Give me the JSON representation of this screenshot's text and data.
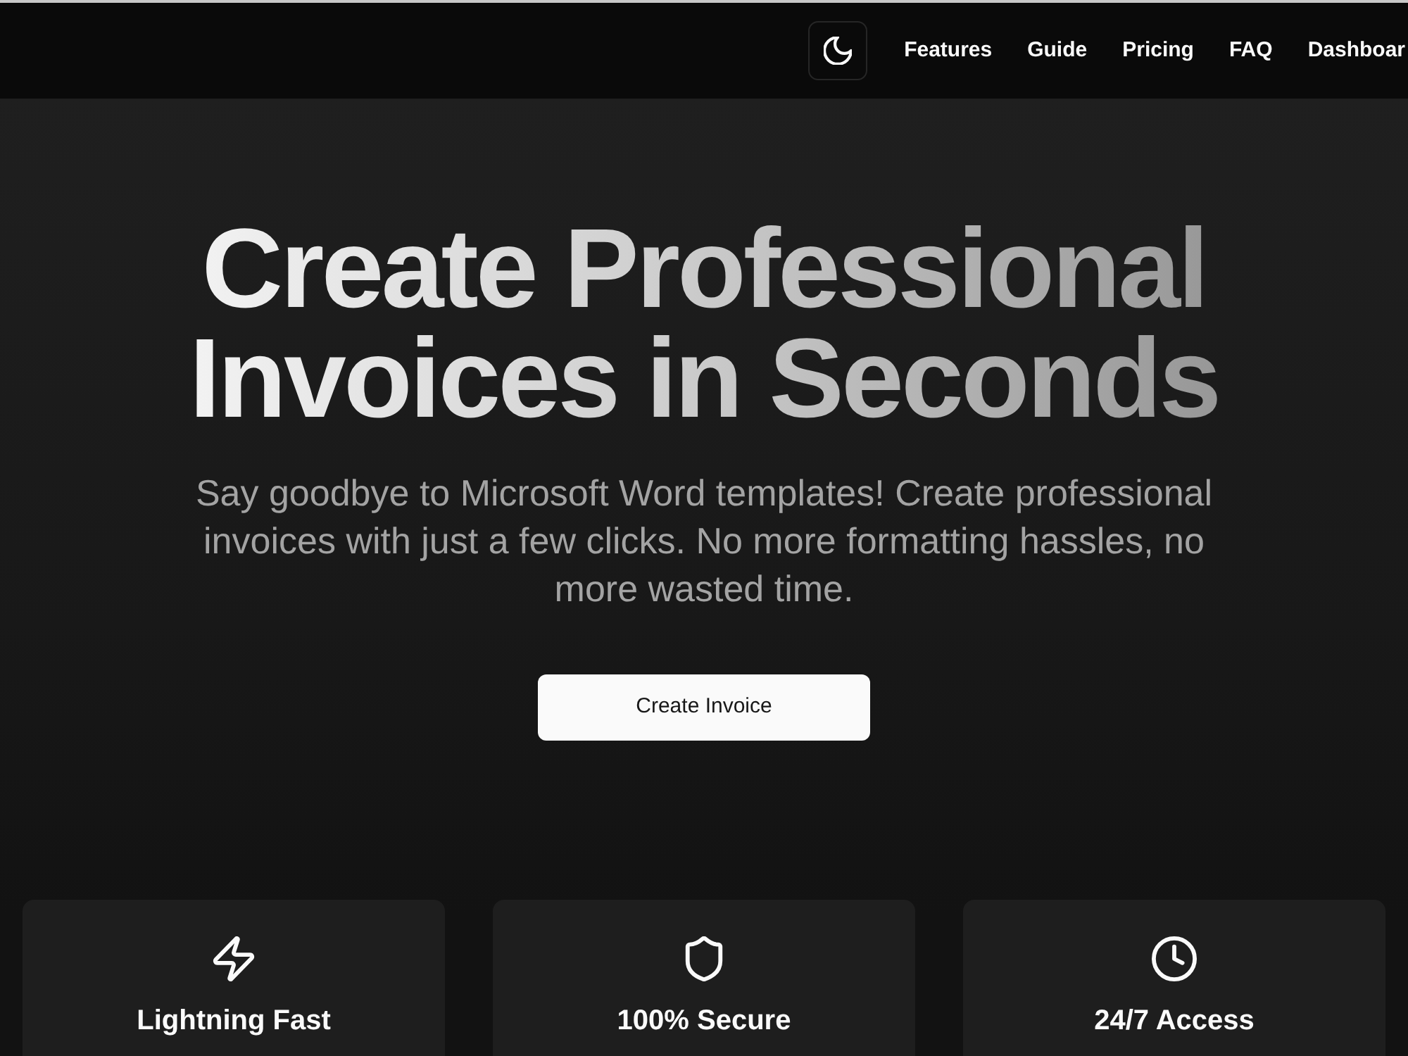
{
  "navbar": {
    "links": [
      "Features",
      "Guide",
      "Pricing",
      "FAQ",
      "Dashboar"
    ]
  },
  "hero": {
    "title": "Create Professional Invoices in Seconds",
    "subtitle": "Say goodbye to Microsoft Word templates! Create professional invoices with just a few clicks. No more formatting hassles, no more wasted time.",
    "cta": "Create Invoice"
  },
  "features": [
    {
      "title": "Lightning Fast"
    },
    {
      "title": "100% Secure"
    },
    {
      "title": "24/7 Access"
    }
  ]
}
